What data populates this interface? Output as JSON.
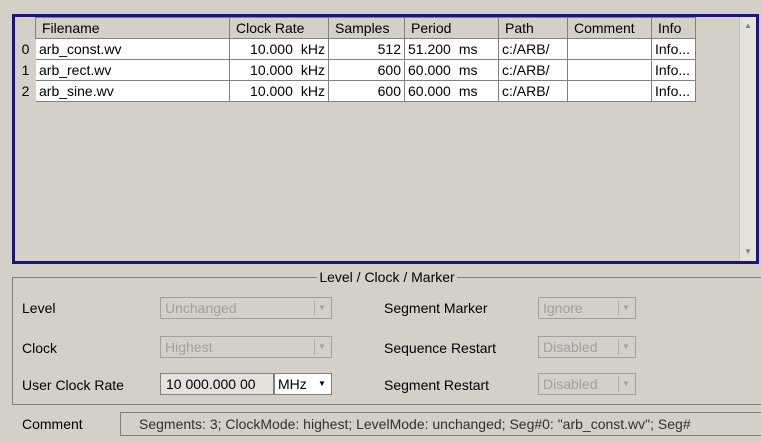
{
  "table": {
    "columns": [
      "Filename",
      "Clock Rate",
      "Samples",
      "Period",
      "Path",
      "Comment",
      "Info"
    ],
    "rows": [
      {
        "index": "0",
        "filename": "arb_const.wv",
        "clock_value": "10.000",
        "clock_unit": "kHz",
        "samples": "512",
        "period_value": "51.200",
        "period_unit": "ms",
        "path": "c:/ARB/",
        "comment": "",
        "info": "Info..."
      },
      {
        "index": "1",
        "filename": "arb_rect.wv",
        "clock_value": "10.000",
        "clock_unit": "kHz",
        "samples": "600",
        "period_value": "60.000",
        "period_unit": "ms",
        "path": "c:/ARB/",
        "comment": "",
        "info": "Info..."
      },
      {
        "index": "2",
        "filename": "arb_sine.wv",
        "clock_value": "10.000",
        "clock_unit": "kHz",
        "samples": "600",
        "period_value": "60.000",
        "period_unit": "ms",
        "path": "c:/ARB/",
        "comment": "",
        "info": "Info..."
      }
    ]
  },
  "settings": {
    "title": "Level / Clock / Marker",
    "level": {
      "label": "Level",
      "value": "Unchanged"
    },
    "clock": {
      "label": "Clock",
      "value": "Highest"
    },
    "user_clock_rate": {
      "label": "User Clock Rate",
      "value": "10 000.000 00",
      "unit": "MHz"
    },
    "segment_marker": {
      "label": "Segment Marker",
      "value": "Ignore"
    },
    "sequence_restart": {
      "label": "Sequence Restart",
      "value": "Disabled"
    },
    "segment_restart": {
      "label": "Segment Restart",
      "value": "Disabled"
    }
  },
  "comment": {
    "label": "Comment",
    "value": "Segments: 3; ClockMode: highest; LevelMode: unchanged; Seg#0: \"arb_const.wv\"; Seg#"
  },
  "icons": {
    "combo_arrow": "chevron-down-icon",
    "scroll_up": "scroll-up-icon",
    "scroll_down": "scroll-down-icon"
  }
}
